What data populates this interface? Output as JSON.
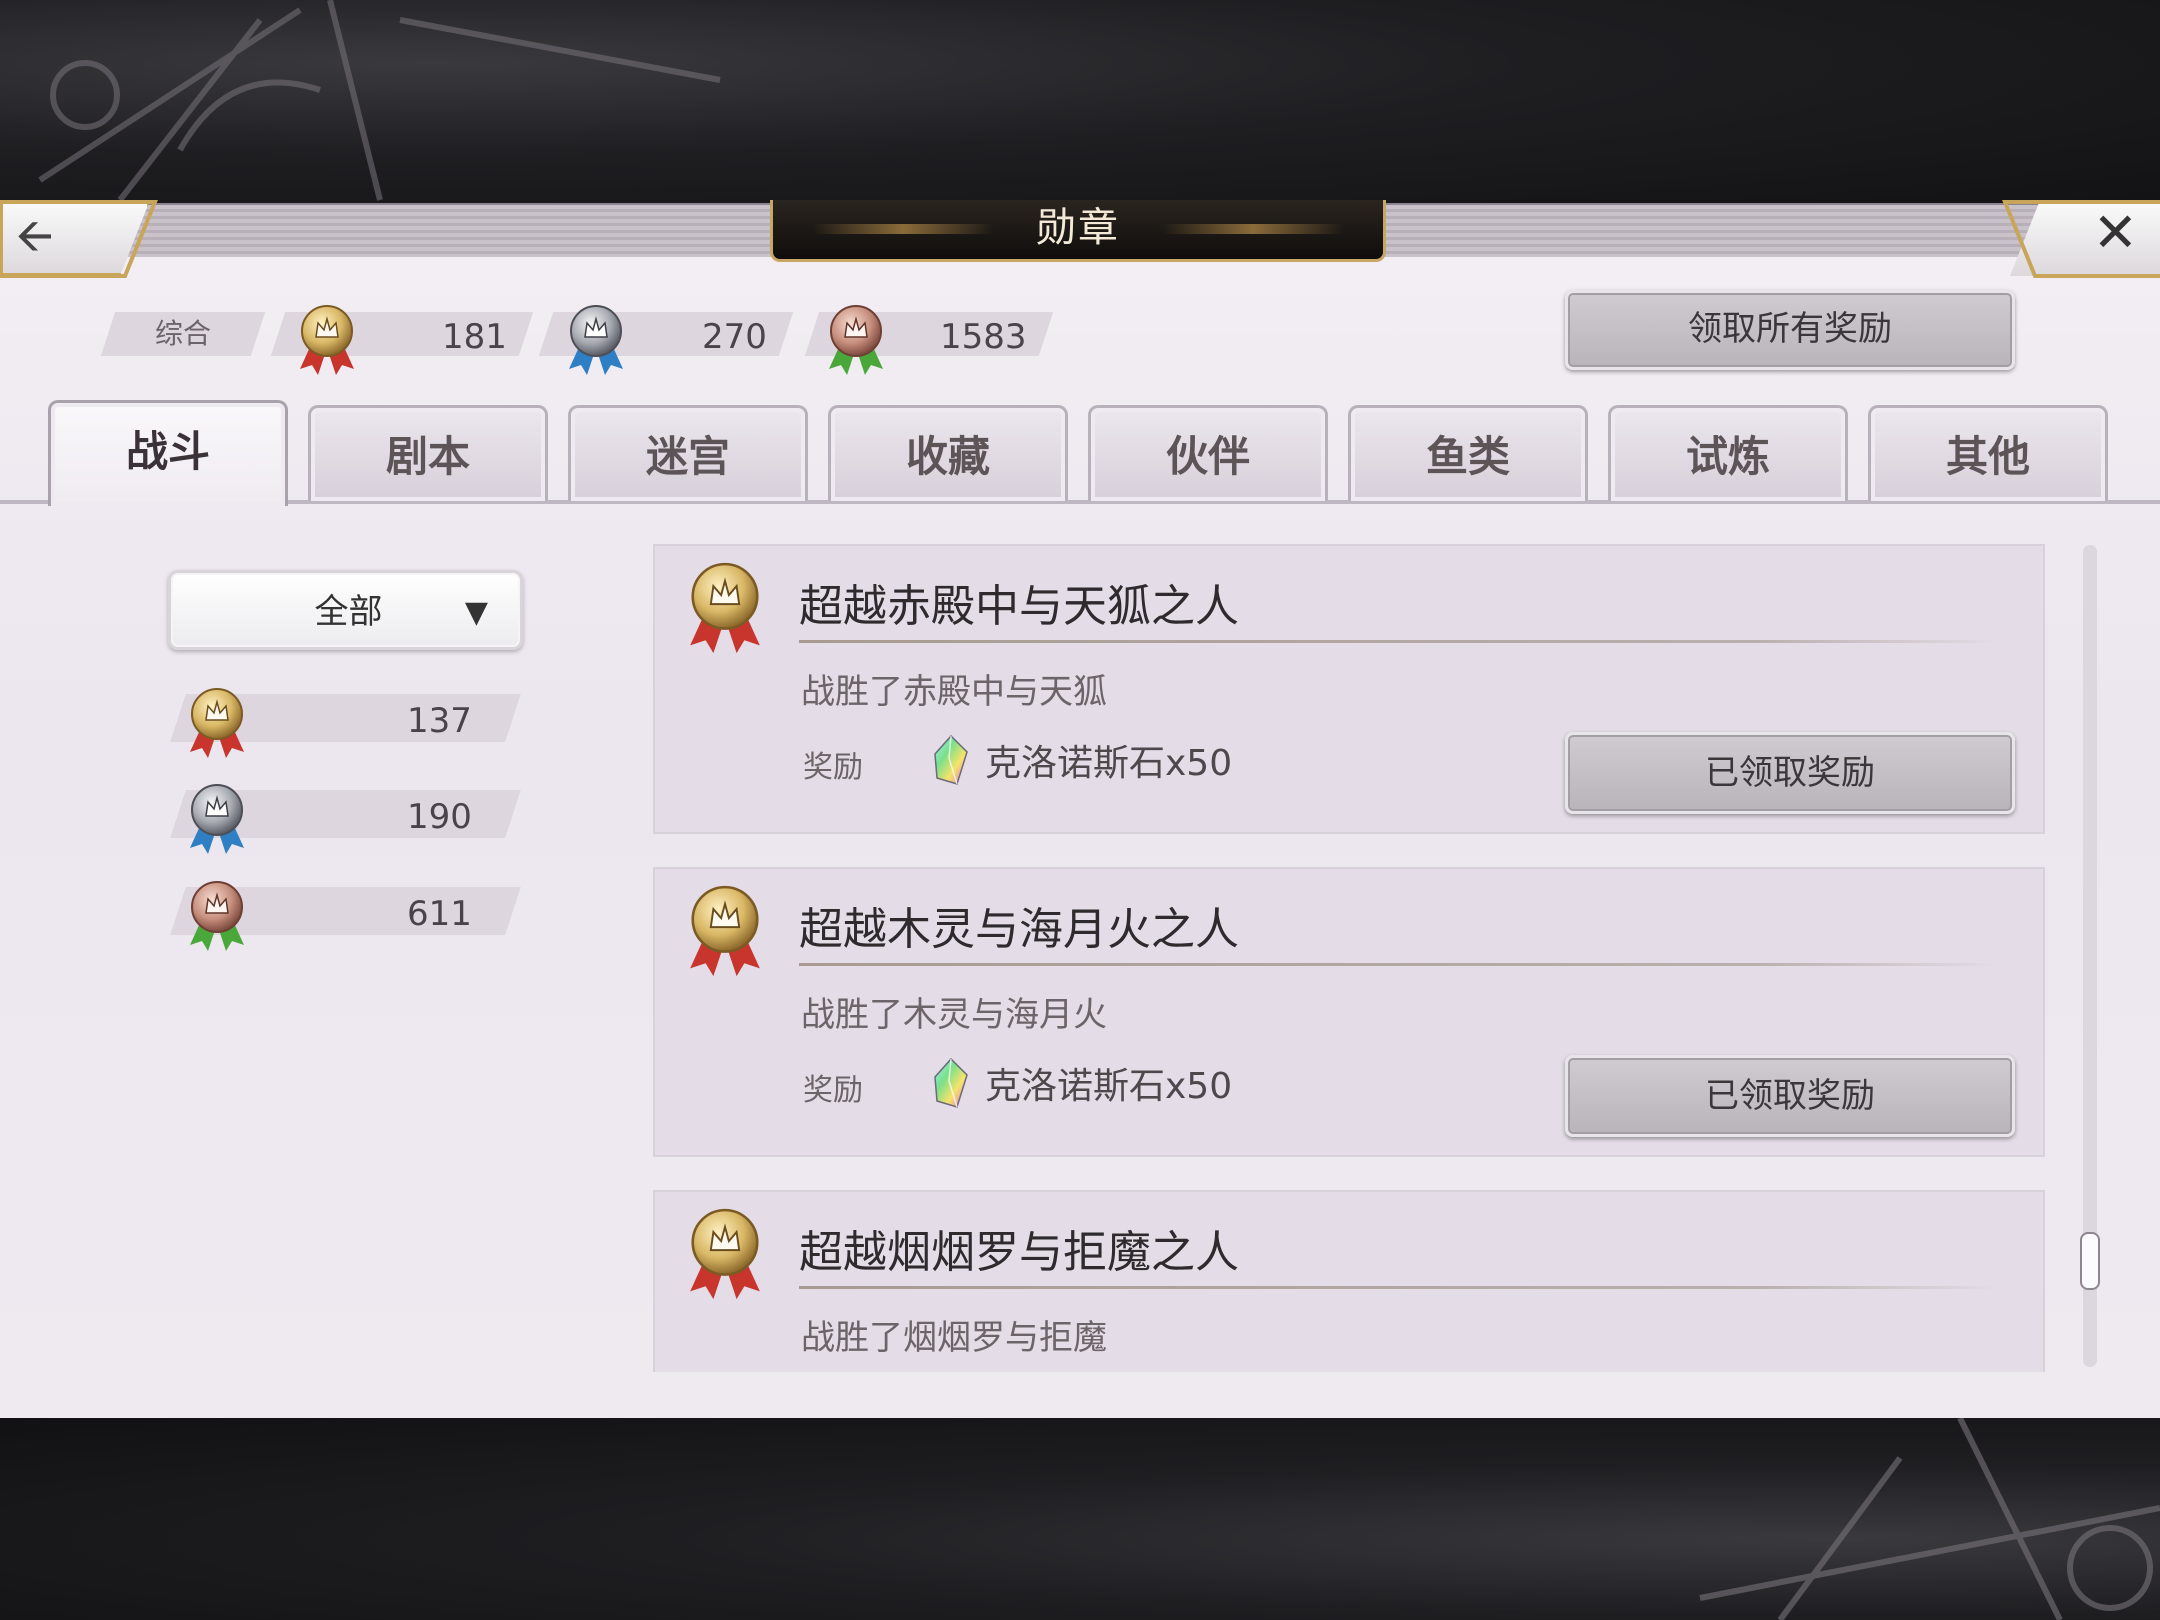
{
  "header": {
    "title": "勋章"
  },
  "summary": {
    "label": "综合",
    "gold_count": "181",
    "silver_count": "270",
    "bronze_count": "1583",
    "claim_all_label": "领取所有奖励"
  },
  "tabs": [
    {
      "label": "战斗",
      "active": true
    },
    {
      "label": "剧本"
    },
    {
      "label": "迷宫"
    },
    {
      "label": "收藏"
    },
    {
      "label": "伙伴"
    },
    {
      "label": "鱼类"
    },
    {
      "label": "试炼"
    },
    {
      "label": "其他"
    }
  ],
  "filter": {
    "selected": "全部",
    "gold_count": "137",
    "silver_count": "190",
    "bronze_count": "611"
  },
  "achievements": [
    {
      "title": "超越赤殿中与天狐之人",
      "description": "战胜了赤殿中与天狐",
      "reward_label": "奖励",
      "reward_item": "克洛诺斯石x50",
      "status_label": "已领取奖励"
    },
    {
      "title": "超越木灵与海月火之人",
      "description": "战胜了木灵与海月火",
      "reward_label": "奖励",
      "reward_item": "克洛诺斯石x50",
      "status_label": "已领取奖励"
    },
    {
      "title": "超越烟烟罗与拒魔之人",
      "description": "战胜了烟烟罗与拒魔"
    }
  ],
  "colors": {
    "gold_medal": "#d9b866",
    "silver_medal": "#a9abb3",
    "bronze_medal": "#c8907f",
    "ribbon_red": "#c8352c",
    "ribbon_blue": "#2f7fc4",
    "ribbon_green": "#4aa83a",
    "title_plate": "#1a1613",
    "panel": "#eee9f0",
    "card": "#e4dce7"
  },
  "icons": {
    "back": "left-arrow-icon",
    "close": "close-icon",
    "medal_gold": "gold-medal-icon",
    "medal_silver": "silver-medal-icon",
    "medal_bronze": "bronze-medal-icon",
    "reward": "chronos-stone-icon",
    "dropdown": "chevron-down-icon"
  }
}
